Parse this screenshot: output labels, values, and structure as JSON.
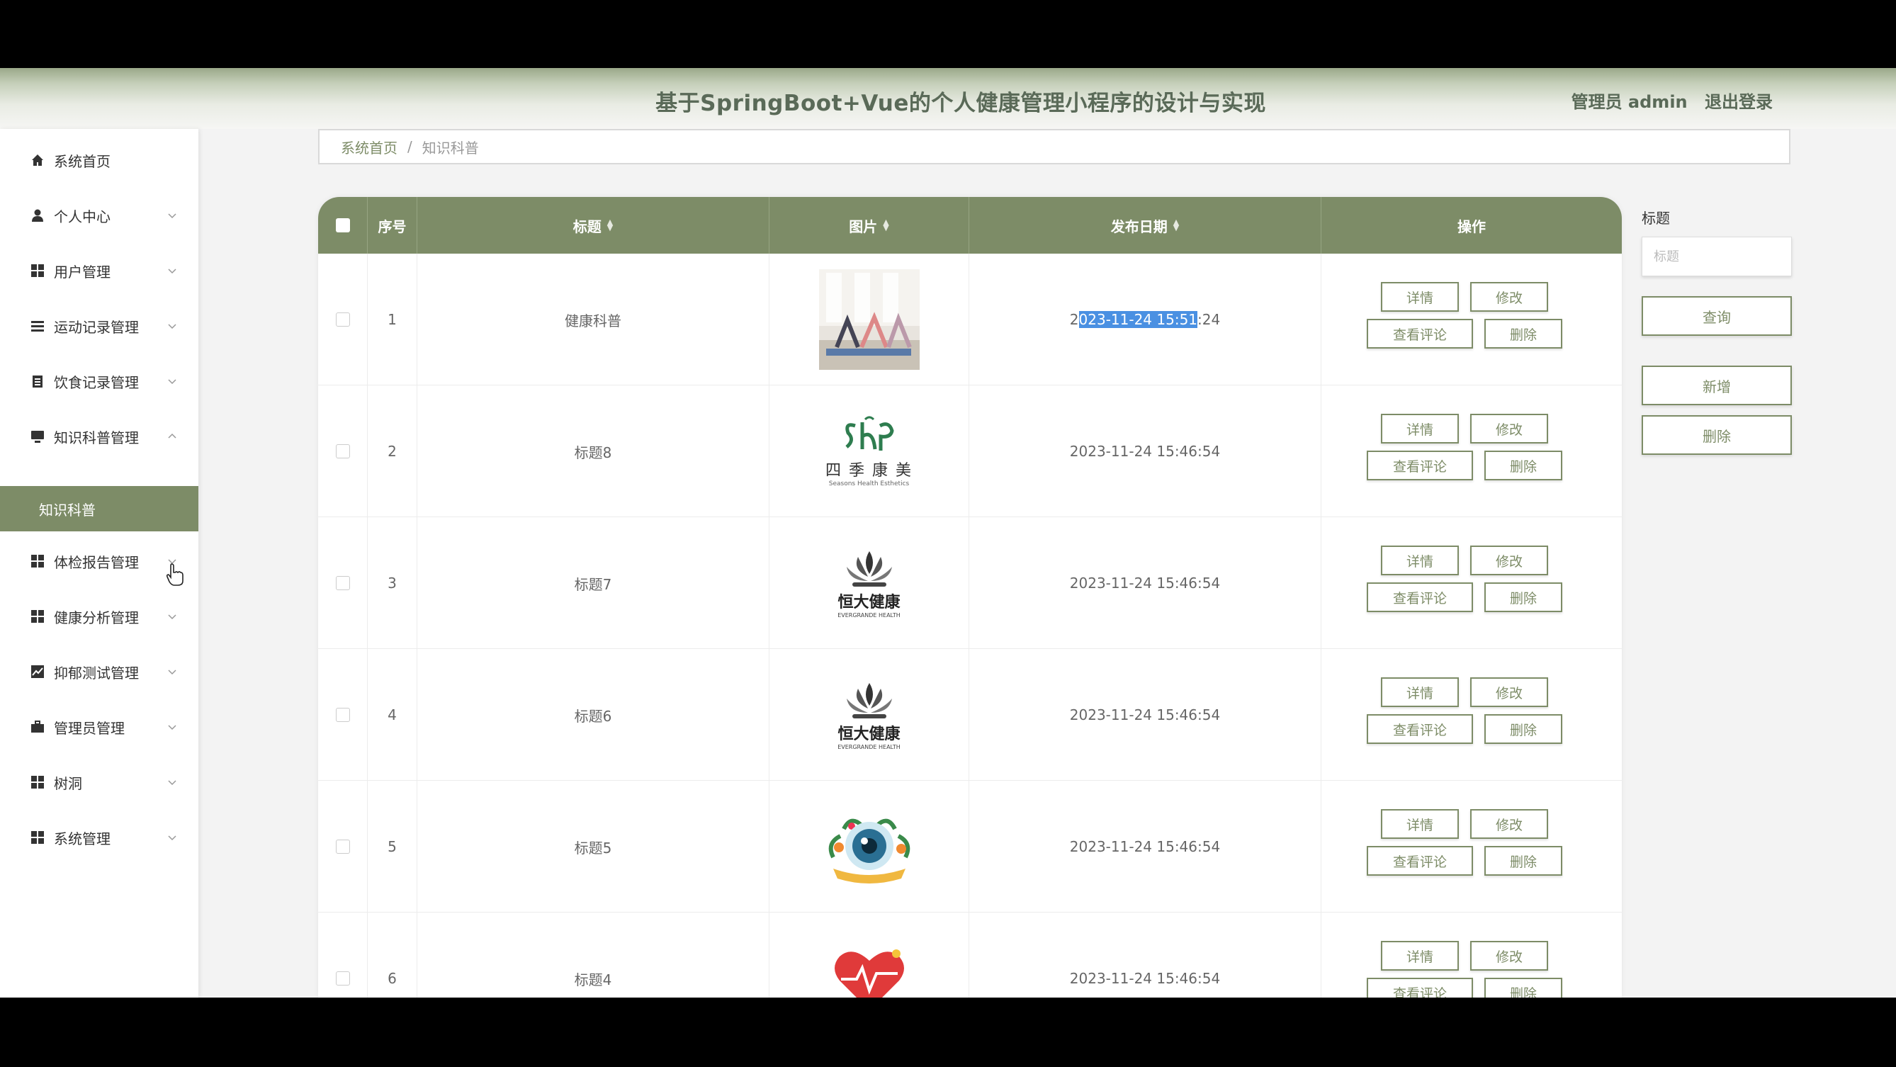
{
  "header": {
    "title": "基于SpringBoot+Vue的个人健康管理小程序的设计与实现",
    "user_role": "管理员 admin",
    "logout": "退出登录"
  },
  "sidebar": {
    "items": [
      {
        "label": "系统首页",
        "icon": "home-icon"
      },
      {
        "label": "个人中心",
        "icon": "person-icon"
      },
      {
        "label": "用户管理",
        "icon": "grid-icon"
      },
      {
        "label": "运动记录管理",
        "icon": "list-icon"
      },
      {
        "label": "饮食记录管理",
        "icon": "clipboard-icon"
      },
      {
        "label": "知识科普管理",
        "icon": "monitor-icon"
      },
      {
        "label": "体检报告管理",
        "icon": "grid-icon"
      },
      {
        "label": "健康分析管理",
        "icon": "grid-icon"
      },
      {
        "label": "抑郁测试管理",
        "icon": "chart-icon"
      },
      {
        "label": "管理员管理",
        "icon": "briefcase-icon"
      },
      {
        "label": "树洞",
        "icon": "grid-icon"
      },
      {
        "label": "系统管理",
        "icon": "grid-icon"
      }
    ],
    "active_sub": "知识科普"
  },
  "breadcrumb": {
    "home": "系统首页",
    "separator": "/",
    "current": "知识科普"
  },
  "table": {
    "headers": {
      "index": "序号",
      "title": "标题",
      "image": "图片",
      "date": "发布日期",
      "actions": "操作"
    },
    "row1_date_parts": [
      "2",
      "023-11-24 15:51",
      ":24"
    ],
    "rows": [
      {
        "index": "1",
        "title": "健康科普",
        "date": "2023-11-24 15:51:24",
        "image": "yoga-photo"
      },
      {
        "index": "2",
        "title": "标题8",
        "date": "2023-11-24 15:46:54",
        "image": "seasons-logo"
      },
      {
        "index": "3",
        "title": "标题7",
        "date": "2023-11-24 15:46:54",
        "image": "evergrande-logo"
      },
      {
        "index": "4",
        "title": "标题6",
        "date": "2023-11-24 15:46:54",
        "image": "evergrande-logo"
      },
      {
        "index": "5",
        "title": "标题5",
        "date": "2023-11-24 15:46:54",
        "image": "eye-logo"
      },
      {
        "index": "6",
        "title": "标题4",
        "date": "2023-11-24 15:46:54",
        "image": "heart-logo"
      }
    ],
    "actions": {
      "detail": "详情",
      "edit": "修改",
      "comments": "查看评论",
      "delete": "删除"
    },
    "logo_text": {
      "seasons_cn": "四 季 康 美",
      "seasons_en": "Seasons Health Esthetics",
      "evergrande_cn": "恒大健康",
      "evergrande_en": "EVERGRANDE HEALTH"
    }
  },
  "search": {
    "label": "标题",
    "placeholder": "标题",
    "query_button": "查询",
    "add_button": "新增",
    "delete_button": "删除"
  },
  "colors": {
    "accent": "#7d8c67",
    "header_text": "#5a6a58",
    "selection": "#4a90e2"
  }
}
